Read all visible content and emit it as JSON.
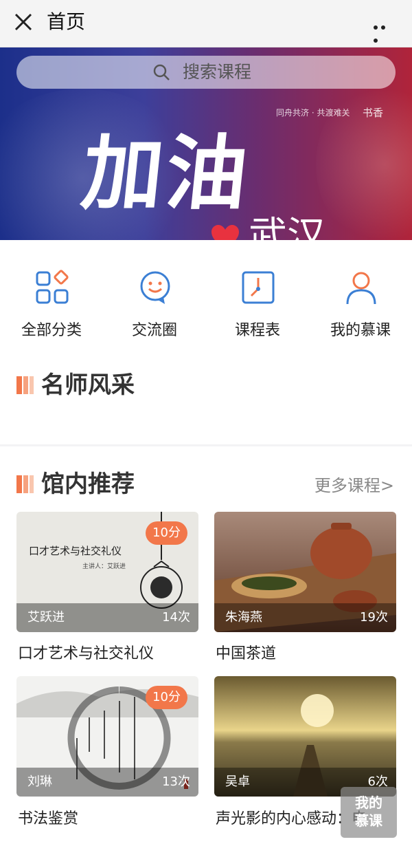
{
  "nav": {
    "title": "首页",
    "close_icon": "close-icon",
    "more_icon": "more-dots-icon"
  },
  "banner": {
    "search_placeholder": "搜索课程",
    "slogan": "同舟共济 · 共渡难关",
    "brand": "书香",
    "title": "加油",
    "subtitle": "武汉",
    "colors": {
      "left": "#1c2f8a",
      "right": "#b0243a",
      "heart": "#e8323f"
    }
  },
  "quick_nav": [
    {
      "label": "全部分类",
      "icon": "category-grid-icon"
    },
    {
      "label": "交流圈",
      "icon": "smile-chat-icon"
    },
    {
      "label": "课程表",
      "icon": "clock-schedule-icon"
    },
    {
      "label": "我的慕课",
      "icon": "user-profile-icon"
    }
  ],
  "sections": {
    "teachers": {
      "title": "名师风采"
    },
    "recommend": {
      "title": "馆内推荐",
      "more": "更多课程>"
    }
  },
  "courses": [
    {
      "title": "口才艺术与社交礼仪",
      "teacher": "艾跃进",
      "count": "14次",
      "badge": "10分",
      "img_text": "口才艺术与社交礼仪",
      "img_sub": "主讲人：艾跃进"
    },
    {
      "title": "中国茶道",
      "teacher": "朱海燕",
      "count": "19次",
      "badge": ""
    },
    {
      "title": "书法鉴赏",
      "teacher": "刘琳",
      "count": "13次",
      "badge": "10分"
    },
    {
      "title": "声光影的内心感动：电",
      "teacher": "吴卓",
      "count": "6次",
      "badge": ""
    }
  ],
  "float_button": {
    "line1": "我的",
    "line2": "慕课"
  },
  "accent": "#f2774a"
}
